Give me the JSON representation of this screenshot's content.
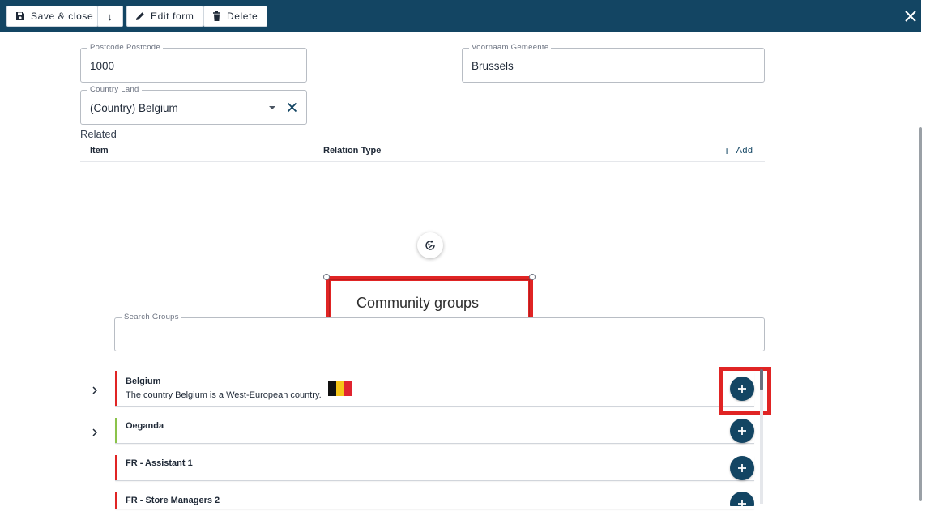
{
  "toolbar": {
    "save_close_label": "Save & close",
    "down_arrow": "↓",
    "edit_form_label": "Edit form",
    "delete_label": "Delete",
    "background_color": "#134563"
  },
  "form": {
    "postcode": {
      "label": "Postcode Postcode",
      "value": "1000"
    },
    "gemeente": {
      "label": "Voornaam Gemeente",
      "value": "Brussels"
    },
    "country": {
      "label": "Country Land",
      "value": "(Country) Belgium"
    }
  },
  "related": {
    "title": "Related",
    "col_item": "Item",
    "col_relation": "Relation Type",
    "add_label": "Add"
  },
  "community": {
    "title": "Community groups",
    "search_label": "Search Groups",
    "search_value": "",
    "groups": [
      {
        "name": "Belgium",
        "description": "The country Belgium is a West-European country.",
        "accent": "#e02424",
        "has_flag": true
      },
      {
        "name": "Oeganda",
        "description": "",
        "accent": "#8bc34a",
        "has_flag": false
      },
      {
        "name": "FR - Assistant 1",
        "description": "",
        "accent": "#e02424",
        "has_flag": false
      },
      {
        "name": "FR - Store Managers 2",
        "description": "",
        "accent": "#e02424",
        "has_flag": false
      }
    ]
  },
  "colors": {
    "primary": "#134563",
    "highlight": "#e02424",
    "flag": [
      "#111111",
      "#f5c518",
      "#e0242f"
    ]
  }
}
